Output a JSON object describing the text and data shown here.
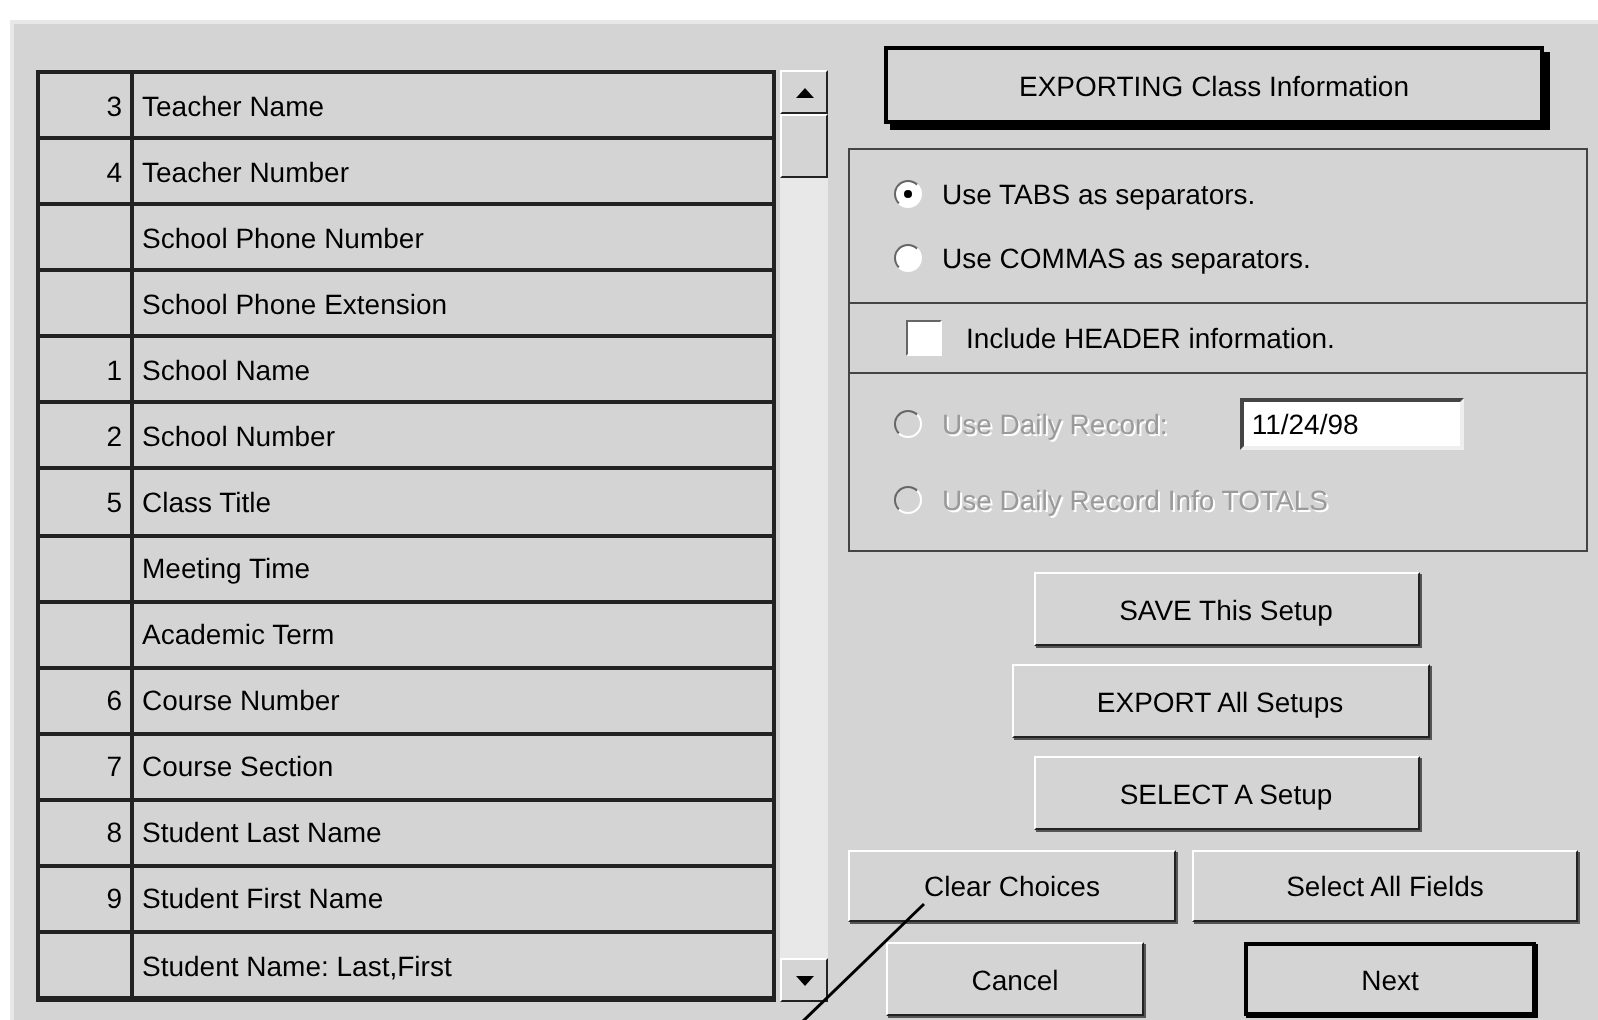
{
  "fields": [
    {
      "order": "3",
      "name": "Teacher Name"
    },
    {
      "order": "4",
      "name": "Teacher Number"
    },
    {
      "name": "School Phone Number"
    },
    {
      "name": "School Phone Extension"
    },
    {
      "order": "1",
      "name": "School Name"
    },
    {
      "order": "2",
      "name": "School Number"
    },
    {
      "order": "5",
      "name": "Class Title"
    },
    {
      "name": "Meeting Time"
    },
    {
      "name": "Academic Term"
    },
    {
      "order": "6",
      "name": "Course Number"
    },
    {
      "order": "7",
      "name": "Course Section"
    },
    {
      "order": "8",
      "name": "Student Last Name"
    },
    {
      "order": "9",
      "name": "Student First Name"
    },
    {
      "name": "Student Name: Last,First"
    }
  ],
  "title_button": "EXPORTING Class Information",
  "separators": [
    {
      "label": "Use TABS as separators.",
      "selected": true
    },
    {
      "label": "Use COMMAS as separators.",
      "selected": false
    }
  ],
  "header_option": {
    "label": "Include HEADER information.",
    "checked": false
  },
  "daily_options": [
    {
      "label": "Use Daily Record:",
      "selected": false,
      "disabled": true,
      "date": "11/24/98"
    },
    {
      "label": "Use Daily Record Info TOTALS",
      "selected": false,
      "disabled": true
    }
  ],
  "setup_buttons": [
    "SAVE This Setup",
    "EXPORT All Setups",
    "SELECT A Setup"
  ],
  "field_buttons": [
    "Clear Choices",
    "Select All Fields"
  ],
  "dialog_buttons": [
    {
      "label": "Cancel",
      "default": false
    },
    {
      "label": "Next",
      "default": true
    }
  ]
}
